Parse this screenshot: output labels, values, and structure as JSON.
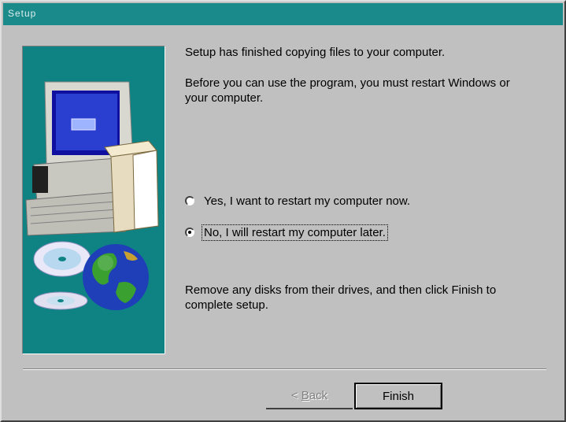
{
  "window": {
    "title": "Setup"
  },
  "body": {
    "line1": "Setup has finished copying files to your computer.",
    "line2": "Before you can use the program, you must restart Windows or",
    "line3": "your computer.",
    "option_yes": "Yes, I want to restart my computer now.",
    "option_no": "No, I will restart my computer later.",
    "selected_option": "no",
    "line4": "Remove any disks from their drives, and then click Finish to",
    "line5": "complete setup."
  },
  "buttons": {
    "back_prefix": "< ",
    "back_accel": "B",
    "back_rest": "ack",
    "finish": "Finish"
  },
  "colors": {
    "titlebar": "#1a8a8a",
    "panel": "#0f8383",
    "face": "#c0c0c0"
  },
  "icons": [
    "computer-illustration",
    "cd-disc-icon",
    "globe-icon"
  ]
}
